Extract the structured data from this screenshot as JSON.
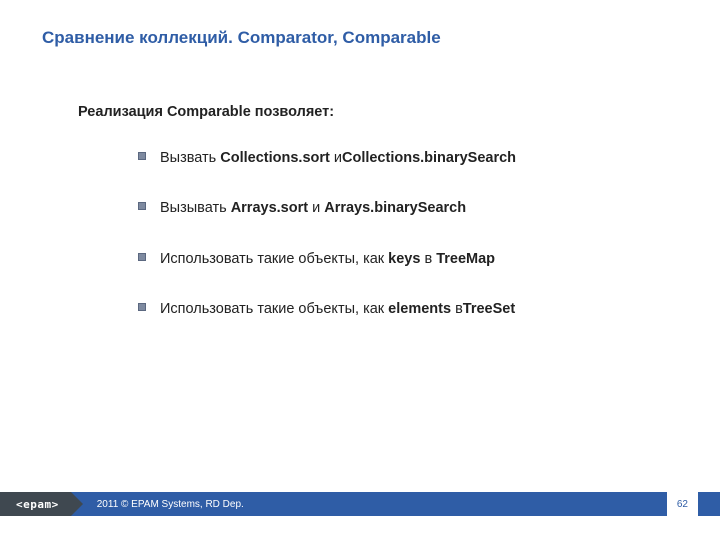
{
  "title": "Сравнение коллекций. Comparator, Comparable",
  "intro": "Реализация Comparable позволяет:",
  "bullets": [
    "Вызвать <b>Collections.sort</b> и<b>Collections.binarySearch</b>",
    "Вызывать <b>Arrays.sort</b> и <b>Arrays.binarySearch</b>",
    "Использовать такие объекты, как <b>keys</b> в <b>TreeMap</b>",
    "Использовать такие объекты, как <b>elements</b> в<b>TreeSet</b>"
  ],
  "footer": {
    "logo": "<epam>",
    "copyright": "2011 © EPAM Systems, RD Dep.",
    "page": "62"
  }
}
